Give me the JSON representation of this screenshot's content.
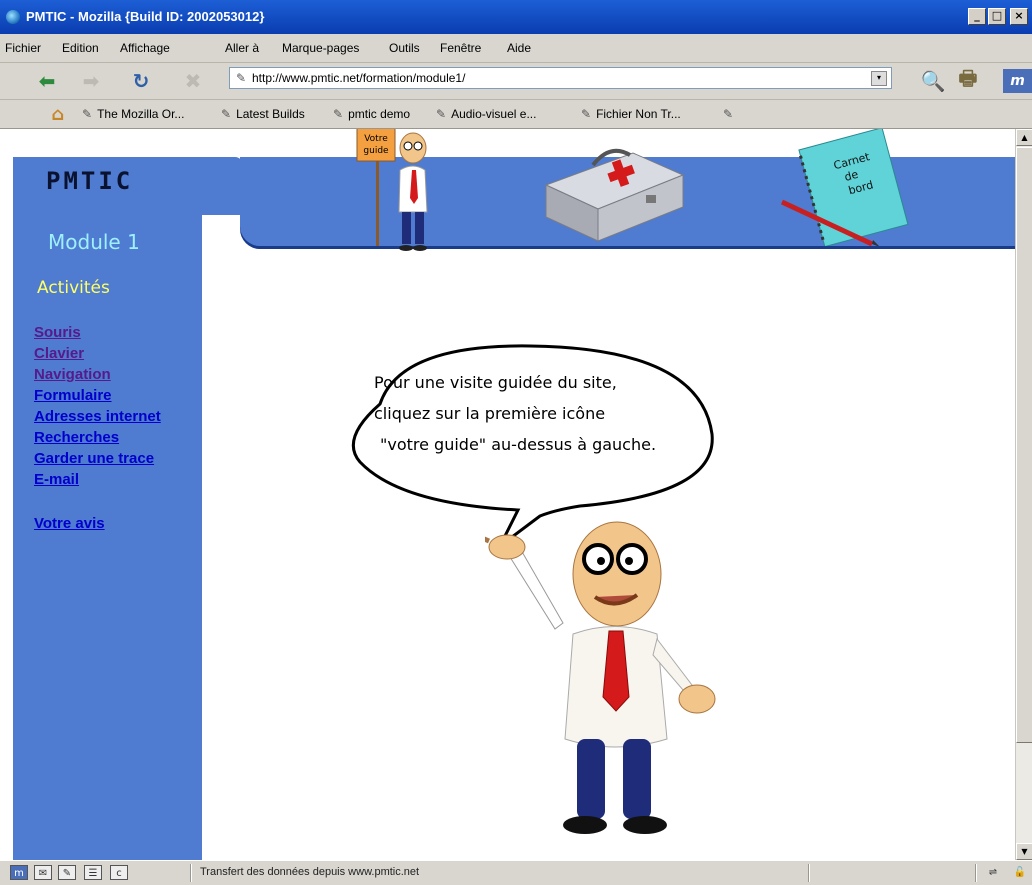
{
  "window": {
    "title": "PMTIC - Mozilla {Build ID: 2002053012}",
    "minimize": "_",
    "maximize": "□",
    "close": "×"
  },
  "menu": [
    "Fichier",
    "Edition",
    "Affichage",
    "Aller à",
    "Marque-pages",
    "Outils",
    "Fenêtre",
    "Aide"
  ],
  "toolbar": {
    "url": "http://www.pmtic.net/formation/module1/"
  },
  "bookmarks": [
    "The Mozilla Or...",
    "Latest Builds",
    "pmtic demo",
    "Audio-visuel e...",
    "Fichier Non Tr..."
  ],
  "page": {
    "logo": "PMTIC",
    "module_title": "Module 1",
    "activities_title": "Activités",
    "guide_sign": "Votre guide",
    "notebook_label": [
      "Carnet",
      "de",
      "bord"
    ],
    "nav_links": [
      {
        "label": "Souris",
        "visited": true
      },
      {
        "label": "Clavier",
        "visited": true
      },
      {
        "label": "Navigation",
        "visited": true
      },
      {
        "label": "Formulaire",
        "visited": false
      },
      {
        "label": "Adresses internet",
        "visited": false
      },
      {
        "label": "Recherches",
        "visited": false
      },
      {
        "label": "Garder une trace",
        "visited": false
      },
      {
        "label": "E-mail",
        "visited": false
      }
    ],
    "feedback_link": "Votre avis",
    "bubble_lines": [
      "Pour une visite guidée du site,",
      "cliquez sur la première icône",
      "\"votre guide\" au-dessus à gauche."
    ]
  },
  "status": {
    "text": "Transfert des données depuis www.pmtic.net"
  },
  "colors": {
    "header_blue": "#4f7bd0",
    "link": "#0000cc",
    "visited_link": "#551a8b",
    "module_title": "#9ef0ff",
    "activities_title": "#ffff66"
  }
}
